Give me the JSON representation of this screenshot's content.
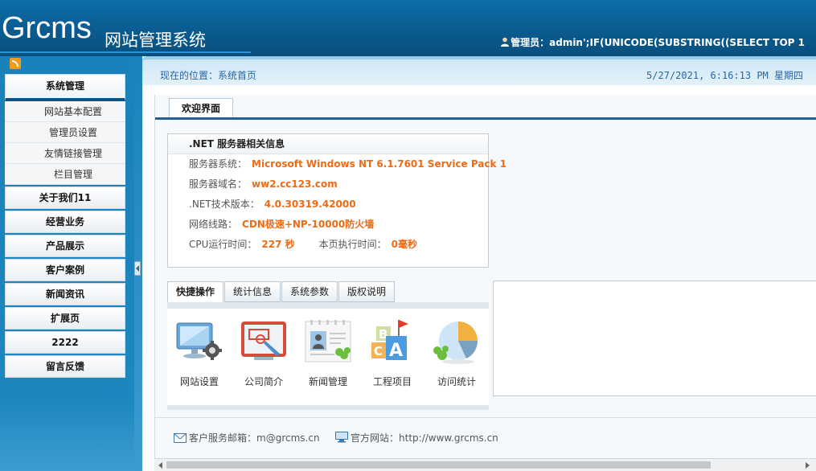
{
  "header": {
    "logo": "Grcms",
    "logo_sub": "网站管理系统",
    "admin_text": "管理员：admin';IF(UNICODE(SUBSTRING((SELECT TOP 1"
  },
  "breadcrumb": {
    "position": "现在的位置：系统首页",
    "datetime": "5/27/2021, 6:16:13 PM 星期四"
  },
  "sidebar": {
    "active_header": "系统管理",
    "sub_items": [
      {
        "label": "网站基本配置"
      },
      {
        "label": "管理员设置"
      },
      {
        "label": "友情链接管理"
      },
      {
        "label": "栏目管理"
      }
    ],
    "categories": [
      {
        "label": "关于我们11"
      },
      {
        "label": "经营业务"
      },
      {
        "label": "产品展示"
      },
      {
        "label": "客户案例"
      },
      {
        "label": "新闻资讯"
      },
      {
        "label": "扩展页"
      },
      {
        "label": "2222"
      },
      {
        "label": "留言反馈"
      }
    ]
  },
  "welcome_tab": "欢迎界面",
  "server_info": {
    "title": ".NET 服务器相关信息",
    "os_label": "服务器系统：",
    "os_value": "Microsoft Windows NT 6.1.7601 Service Pack 1",
    "domain_label": "服务器域名：",
    "domain_value": "ww2.cc123.com",
    "net_label": ".NET技术版本：",
    "net_value": "4.0.30319.42000",
    "line_label": "网络线路：",
    "line_value": "CDN极速+NP-10000防火墙",
    "cpu_label": "CPU运行时间：",
    "cpu_value": "227 秒",
    "exec_label": "本页执行时间：",
    "exec_value": "0毫秒"
  },
  "quick_tabs": [
    {
      "label": "快捷操作"
    },
    {
      "label": "统计信息"
    },
    {
      "label": "系统参数"
    },
    {
      "label": "版权说明"
    }
  ],
  "quick_items": [
    {
      "label": "网站设置",
      "icon": "monitor-gear-icon"
    },
    {
      "label": "公司简介",
      "icon": "presentation-board-icon"
    },
    {
      "label": "新闻管理",
      "icon": "news-card-icon"
    },
    {
      "label": "工程项目",
      "icon": "abc-blocks-icon"
    },
    {
      "label": "访问统计",
      "icon": "pie-chart-icon"
    }
  ],
  "footer": {
    "email_label": "客户服务邮箱：",
    "email_value": "m@grcms.cn",
    "site_label": "官方网站：",
    "site_value": "http://www.grcms.cn"
  },
  "colors": {
    "header_blue": "#0a5b8f",
    "accent_orange": "#ee6a13",
    "link_blue": "#2a66a8"
  }
}
